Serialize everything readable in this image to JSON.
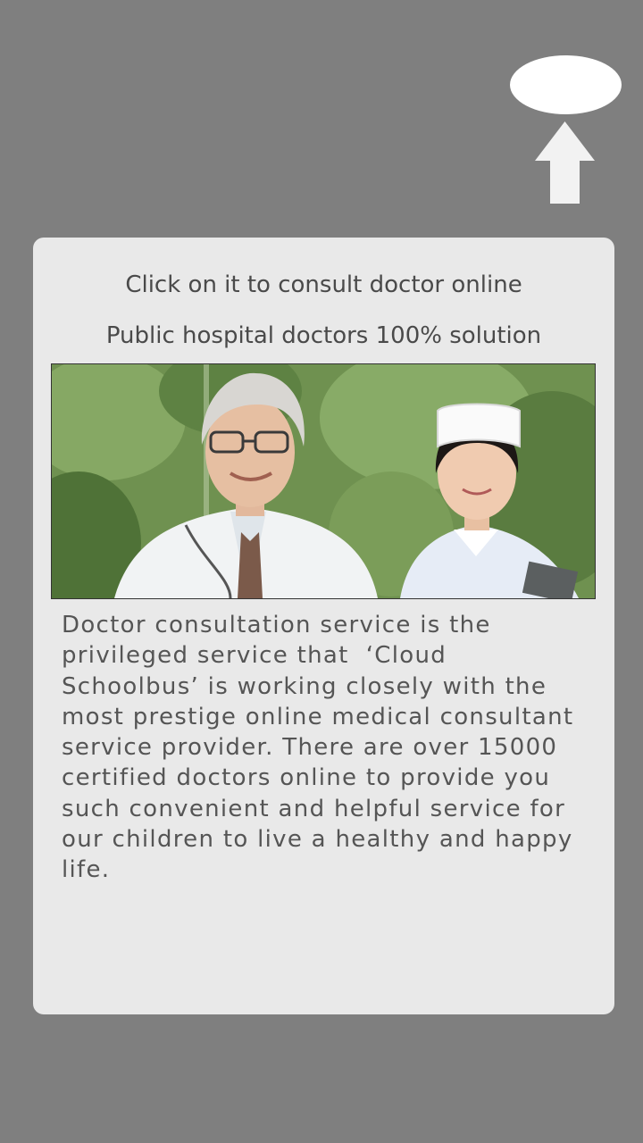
{
  "hint": {
    "headline": "Click on it to consult doctor online",
    "subheadline": "Public hospital doctors 100% solution",
    "description": "Doctor consultation service is the\nprivileged service that  ‘Cloud\nSchoolbus’ is working closely with the\nmost prestige online medical consultant\nservice provider. There are over 15000\ncertified doctors online to provide you\nsuch convenient and helpful service for\nour children to live a healthy and happy\nlife.",
    "icons": [
      "highlight-oval",
      "up-arrow-icon"
    ]
  },
  "colors": {
    "overlay": "#7f7f7f",
    "card": "#e9e9e9",
    "text": "#4a4a4a",
    "highlight": "#ffffff",
    "arrow": "#f2f2f2"
  }
}
